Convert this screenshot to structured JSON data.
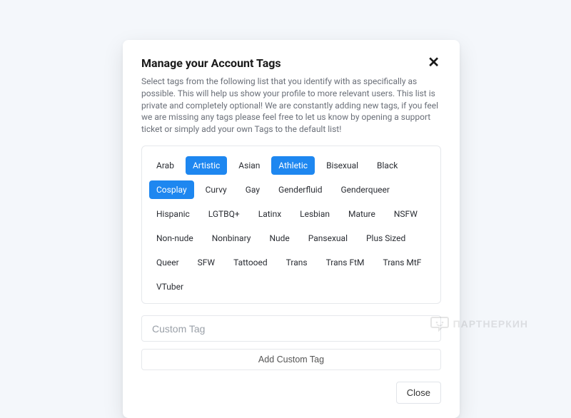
{
  "dialog": {
    "title": "Manage your Account Tags",
    "close_x": "✕",
    "description": "Select tags from the following list that you identify with as specifically as possible. This will help us show your profile to more relevant users. This list is private and completely optional! We are constantly adding new tags, if you feel we are missing any tags please feel free to let us know by opening a support ticket or simply add your own Tags to the default list!",
    "tags": [
      {
        "label": "Arab",
        "selected": false
      },
      {
        "label": "Artistic",
        "selected": true
      },
      {
        "label": "Asian",
        "selected": false
      },
      {
        "label": "Athletic",
        "selected": true
      },
      {
        "label": "Bisexual",
        "selected": false
      },
      {
        "label": "Black",
        "selected": false
      },
      {
        "label": "Cosplay",
        "selected": true
      },
      {
        "label": "Curvy",
        "selected": false
      },
      {
        "label": "Gay",
        "selected": false
      },
      {
        "label": "Genderfluid",
        "selected": false
      },
      {
        "label": "Genderqueer",
        "selected": false
      },
      {
        "label": "Hispanic",
        "selected": false
      },
      {
        "label": "LGTBQ+",
        "selected": false
      },
      {
        "label": "Latinx",
        "selected": false
      },
      {
        "label": "Lesbian",
        "selected": false
      },
      {
        "label": "Mature",
        "selected": false
      },
      {
        "label": "NSFW",
        "selected": false
      },
      {
        "label": "Non-nude",
        "selected": false
      },
      {
        "label": "Nonbinary",
        "selected": false
      },
      {
        "label": "Nude",
        "selected": false
      },
      {
        "label": "Pansexual",
        "selected": false
      },
      {
        "label": "Plus Sized",
        "selected": false
      },
      {
        "label": "Queer",
        "selected": false
      },
      {
        "label": "SFW",
        "selected": false
      },
      {
        "label": "Tattooed",
        "selected": false
      },
      {
        "label": "Trans",
        "selected": false
      },
      {
        "label": "Trans FtM",
        "selected": false
      },
      {
        "label": "Trans MtF",
        "selected": false
      },
      {
        "label": "VTuber",
        "selected": false
      }
    ],
    "custom_input_placeholder": "Custom Tag",
    "add_custom_button": "Add Custom Tag",
    "close_button": "Close"
  },
  "watermark": {
    "text": "ПАРТНЕРКИН"
  }
}
